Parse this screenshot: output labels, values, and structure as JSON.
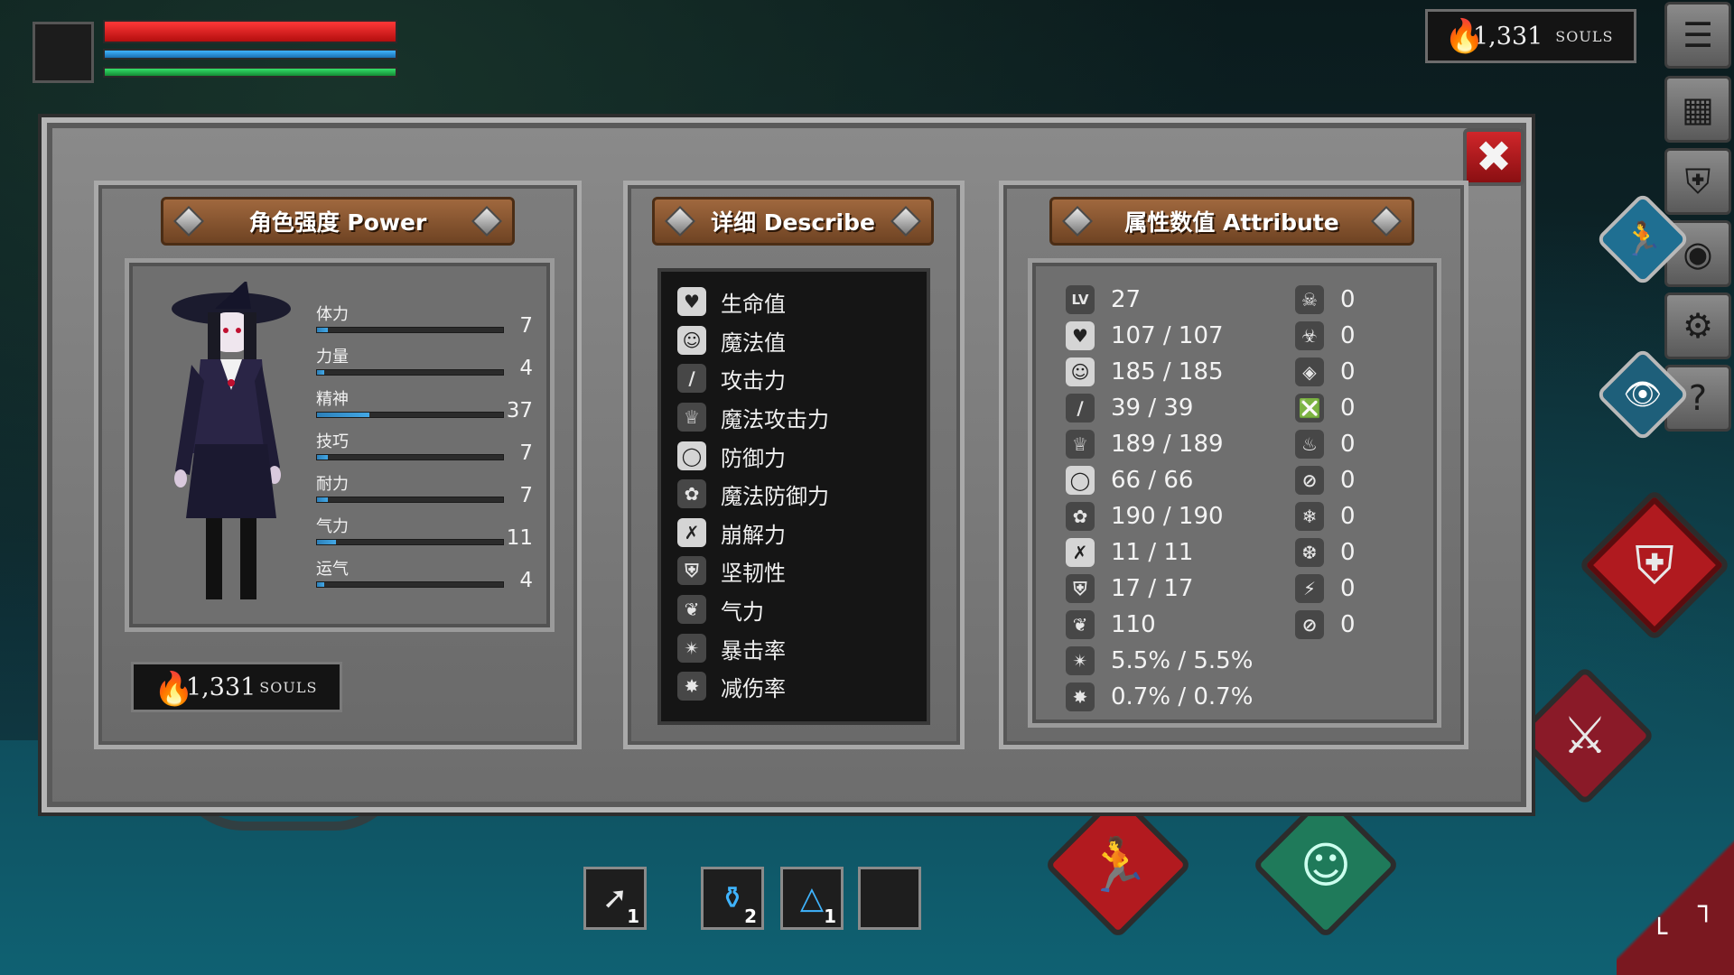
{
  "hud": {
    "souls_amount": "1,331",
    "souls_unit": "SOULS"
  },
  "panels": {
    "power_title": "角色强度 Power",
    "describe_title": "详细 Describe",
    "attribute_title": "属性数值 Attribute"
  },
  "power_stats": [
    {
      "label": "体力",
      "value": "7",
      "fill": 0.06
    },
    {
      "label": "力量",
      "value": "4",
      "fill": 0.04
    },
    {
      "label": "精神",
      "value": "37",
      "fill": 0.28
    },
    {
      "label": "技巧",
      "value": "7",
      "fill": 0.06
    },
    {
      "label": "耐力",
      "value": "7",
      "fill": 0.06
    },
    {
      "label": "气力",
      "value": "11",
      "fill": 0.1
    },
    {
      "label": "运气",
      "value": "4",
      "fill": 0.04
    }
  ],
  "describe_items": [
    {
      "icon": "heart-icon",
      "label": "生命值"
    },
    {
      "icon": "mana-head-icon",
      "label": "魔法值"
    },
    {
      "icon": "sword-icon",
      "label": "攻击力"
    },
    {
      "icon": "magic-attack-icon",
      "label": "魔法攻击力"
    },
    {
      "icon": "shield-icon",
      "label": "防御力"
    },
    {
      "icon": "magic-defense-icon",
      "label": "魔法防御力"
    },
    {
      "icon": "break-icon",
      "label": "崩解力"
    },
    {
      "icon": "helmet-icon",
      "label": "坚韧性"
    },
    {
      "icon": "lungs-icon",
      "label": "气力"
    },
    {
      "icon": "critical-star-icon",
      "label": "暴击率"
    },
    {
      "icon": "damage-reduction-icon",
      "label": "减伤率"
    }
  ],
  "attributes_left": [
    {
      "icon": "LV",
      "value": "27"
    },
    {
      "icon": "heart-icon",
      "value": "107 / 107"
    },
    {
      "icon": "mana-head-icon",
      "value": "185 / 185"
    },
    {
      "icon": "sword-icon",
      "value": "39 / 39"
    },
    {
      "icon": "magic-attack-icon",
      "value": "189 / 189"
    },
    {
      "icon": "shield-icon",
      "value": "66 / 66"
    },
    {
      "icon": "magic-defense-icon",
      "value": "190 / 190"
    },
    {
      "icon": "break-icon",
      "value": "11 / 11"
    },
    {
      "icon": "helmet-icon",
      "value": "17 / 17"
    },
    {
      "icon": "lungs-icon",
      "value": "110"
    },
    {
      "icon": "critical-star-icon",
      "value": "5.5% / 5.5%"
    },
    {
      "icon": "damage-reduction-icon",
      "value": "0.7% / 0.7%"
    }
  ],
  "attributes_right": [
    {
      "icon": "skull-icon",
      "value": "0"
    },
    {
      "icon": "poison-skull-icon",
      "value": "0"
    },
    {
      "icon": "drop-icon",
      "value": "0"
    },
    {
      "icon": "bleed-icon",
      "value": "0"
    },
    {
      "icon": "fire-icon",
      "value": "0"
    },
    {
      "icon": "fire-resist-icon",
      "value": "0"
    },
    {
      "icon": "frost-icon",
      "value": "0"
    },
    {
      "icon": "frost-resist-icon",
      "value": "0"
    },
    {
      "icon": "lightning-icon",
      "value": "0"
    },
    {
      "icon": "lightning-resist-icon",
      "value": "0"
    }
  ],
  "hotbar": [
    {
      "icon": "arrow-icon",
      "count": "1"
    },
    {
      "icon": "blue-potion-icon",
      "count": "2"
    },
    {
      "icon": "flask-icon",
      "count": "1"
    },
    {
      "icon": "empty-slot",
      "count": ""
    }
  ],
  "colors": {
    "hp": "#e01e1e",
    "mp": "#2f8fd6",
    "stamina": "#1fb14a",
    "banner": "#8a5730",
    "close": "#c0191d"
  }
}
